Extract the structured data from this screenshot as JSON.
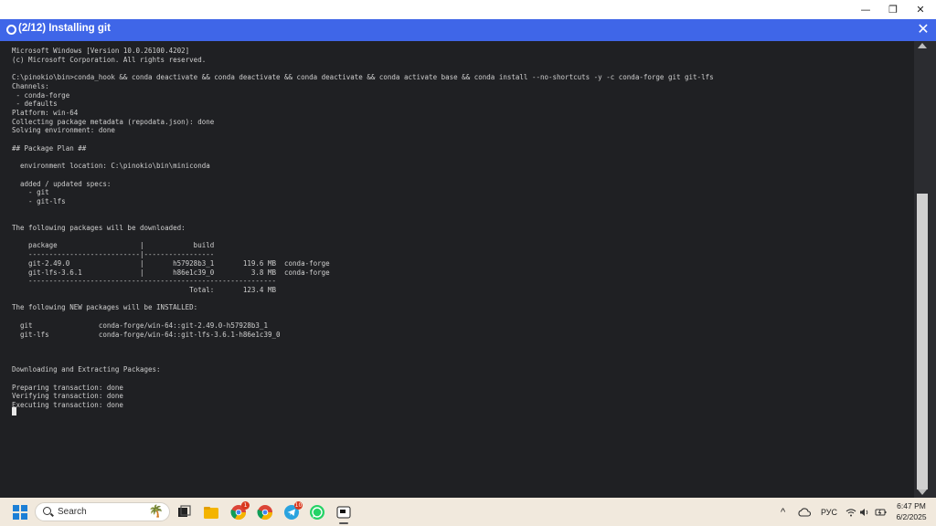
{
  "window": {
    "minimize_glyph": "—",
    "restore_glyph": "❐",
    "close_glyph": "✕"
  },
  "header": {
    "title": "(2/12) Installing git",
    "close_glyph": "✕",
    "color": "#3f66e8"
  },
  "terminal": {
    "lines": [
      "Microsoft Windows [Version 10.0.26100.4202]",
      "(c) Microsoft Corporation. All rights reserved.",
      "",
      "C:\\pinokio\\bin>conda_hook && conda deactivate && conda deactivate && conda deactivate && conda activate base && conda install --no-shortcuts -y -c conda-forge git git-lfs",
      "Channels:",
      " - conda-forge",
      " - defaults",
      "Platform: win-64",
      "Collecting package metadata (repodata.json): done",
      "Solving environment: done",
      "",
      "## Package Plan ##",
      "",
      "  environment location: C:\\pinokio\\bin\\miniconda",
      "",
      "  added / updated specs:",
      "    - git",
      "    - git-lfs",
      "",
      "",
      "The following packages will be downloaded:",
      "",
      "    package                    |            build",
      "    ---------------------------|-----------------",
      "    git-2.49.0                 |       h57928b3_1       119.6 MB  conda-forge",
      "    git-lfs-3.6.1              |       h86e1c39_0         3.8 MB  conda-forge",
      "    ------------------------------------------------------------",
      "                                           Total:       123.4 MB",
      "",
      "The following NEW packages will be INSTALLED:",
      "",
      "  git                conda-forge/win-64::git-2.49.0-h57928b3_1",
      "  git-lfs            conda-forge/win-64::git-lfs-3.6.1-h86e1c39_0",
      "",
      "",
      "",
      "Downloading and Extracting Packages:",
      "",
      "Preparing transaction: done",
      "Verifying transaction: done",
      "Executing transaction: done"
    ]
  },
  "taskbar": {
    "search_placeholder": "Search",
    "chrome_badge": "1",
    "telegram_badge": "10",
    "tray_chevron": "^",
    "language": "РУС",
    "time": "6:47 PM",
    "date": "6/2/2025"
  },
  "icons": {
    "start": "windows-start-icon",
    "search": "search-icon",
    "task_view": "task-view-icon",
    "explorer": "file-explorer-icon",
    "chrome": "chrome-icon",
    "telegram": "telegram-icon",
    "whatsapp": "whatsapp-icon",
    "pinokio": "pinokio-icon"
  }
}
